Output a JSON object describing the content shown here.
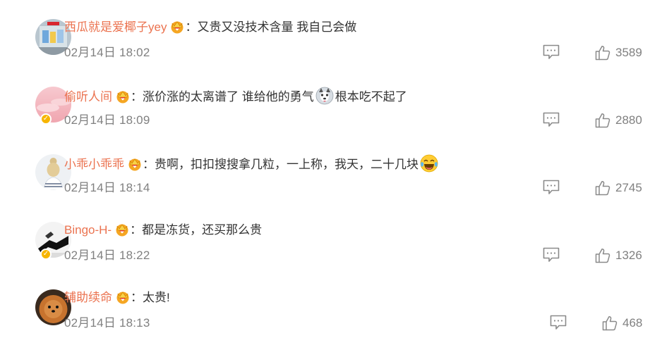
{
  "colors": {
    "username": "#eb7350",
    "meta": "#808080",
    "text": "#333333",
    "verified": "#f7b500"
  },
  "comments": [
    {
      "username": "西瓜就是爱椰子yey",
      "separator": "：",
      "text": "又贵又没技术含量 我自己会做",
      "text_after_emoji": "",
      "emoji": "",
      "time": "02月14日 18:02",
      "likes": "3589",
      "verified": false,
      "avatar_icon": "supreme-shop-avatar"
    },
    {
      "username": "偷听人间",
      "separator": "：",
      "text": "涨价涨的太离谱了 谁给他的勇气",
      "text_after_emoji": "根本吃不起了",
      "emoji": "husky-dog-emoji",
      "time": "02月14日 18:09",
      "likes": "2880",
      "verified": true,
      "avatar_icon": "pink-cloud-avatar"
    },
    {
      "username": "小乖小乖乖",
      "separator": "：",
      "text": "贵啊，扣扣搜搜拿几粒，一上称，我天，二十几块",
      "text_after_emoji": "",
      "emoji": "laughing-tears-emoji",
      "time": "02月14日 18:14",
      "likes": "2745",
      "verified": false,
      "avatar_icon": "girl-bun-avatar"
    },
    {
      "username": "Bingo-H-",
      "separator": "：",
      "text": "都是冻货，还买那么贵",
      "text_after_emoji": "",
      "emoji": "",
      "time": "02月14日 18:22",
      "likes": "1326",
      "verified": true,
      "avatar_icon": "dark-figure-avatar"
    },
    {
      "username": "辅助续命",
      "separator": "：",
      "text": "太贵!",
      "text_after_emoji": "",
      "emoji": "",
      "time": "02月14日 18:13",
      "likes": "468",
      "verified": false,
      "avatar_icon": "pomeranian-dog-avatar"
    }
  ]
}
